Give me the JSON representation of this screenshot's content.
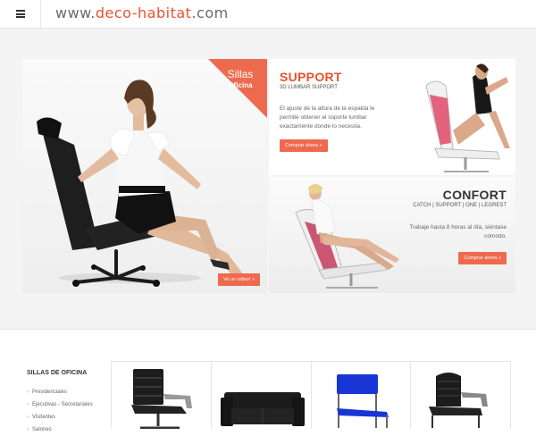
{
  "header": {
    "logo_prefix": "www.",
    "logo_brand": "deco-habitat",
    "logo_suffix": ".com",
    "menu_icon": "menu-icon"
  },
  "hero": {
    "main": {
      "corner_title": "Sillas",
      "corner_subtitle": "Oficina",
      "button": "Ve un video! »"
    },
    "support": {
      "title": "SUPPORT",
      "subtitle": "3D LUMBAR SUPPORT",
      "description": "El ajuste de la altura de la espalda le permite obtener el soporte lumbar exactamente donde lo necesita.",
      "button": "Comprar ahora »"
    },
    "confort": {
      "title": "CONFORT",
      "subtitle": "CATCH | SUPPORT | ONE | LEGREST",
      "description": "Trabaje hasta 8 horas al día, siéntase cómodo.",
      "button": "Comprar ahora »"
    }
  },
  "sidebar": {
    "title": "SILLAS DE OFICINA",
    "items": [
      "Presidenciales",
      "Ejecutivas - Secretariales",
      "Visitantes",
      "Salones"
    ]
  },
  "colors": {
    "accent": "#ee6a4f",
    "text_dark": "#333333",
    "panel_bg": "#f4f4f4"
  }
}
